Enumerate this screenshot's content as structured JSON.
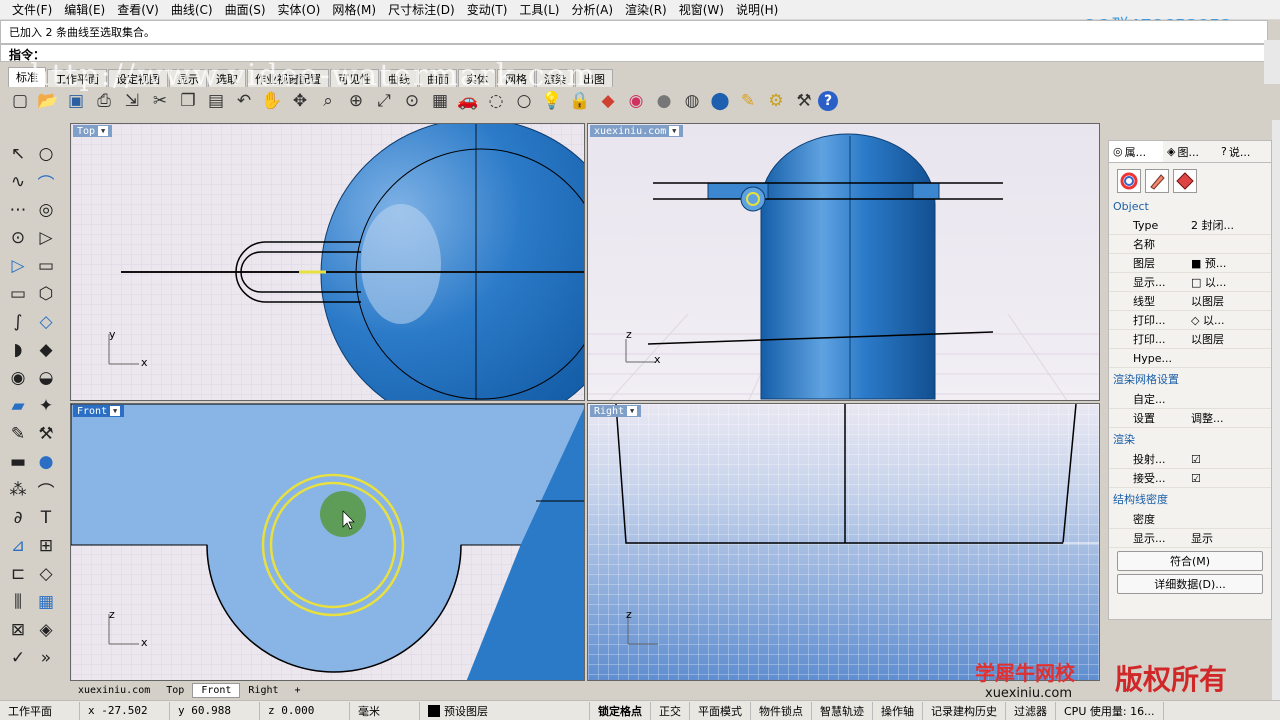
{
  "menu": [
    "文件(F)",
    "编辑(E)",
    "查看(V)",
    "曲线(C)",
    "曲面(S)",
    "实体(O)",
    "网格(M)",
    "尺寸标注(D)",
    "变动(T)",
    "工具(L)",
    "分析(A)",
    "渲染(R)",
    "视窗(W)",
    "说明(H)"
  ],
  "qq": "QQ群478653852",
  "history_text": "已加入 2 条曲线至选取集合。",
  "command_label": "指令：",
  "watermark": "http://www.video-watermark.com",
  "tabs": [
    "标准",
    "工作平面",
    "设定视图",
    "显示",
    "选取",
    "作业视窗配置",
    "可见性",
    "曲线",
    "曲面",
    "实体",
    "网格",
    "渲染",
    "出图"
  ],
  "toolbar_icons": [
    "new-file-icon",
    "open-icon",
    "save-icon",
    "print-icon",
    "import-icon",
    "cut-icon",
    "copy-icon",
    "paste-icon",
    "undo-icon",
    "pan-icon",
    "rotate-icon",
    "zoom-icon",
    "zoom-window-icon",
    "zoom-extents-icon",
    "zoom-selected-icon",
    "grid-icon",
    "car-icon",
    "select-icon",
    "circle-icon",
    "light-icon",
    "lock-icon",
    "layer-icon",
    "color-icon",
    "sphere-icon",
    "render-icon",
    "ball-icon",
    "pen-icon",
    "gear-icon",
    "options-icon",
    "help-icon"
  ],
  "viewports": {
    "top": {
      "name": "Top"
    },
    "persp": {
      "name": "xuexiniu.com"
    },
    "front": {
      "name": "Front"
    },
    "right": {
      "name": "Right"
    }
  },
  "axes": {
    "x": "x",
    "y": "y",
    "z": "z"
  },
  "panel": {
    "tabs": [
      "属...",
      "图...",
      "说..."
    ],
    "object_header": "Object",
    "rows": [
      {
        "k": "Type",
        "v": "2 封闭..."
      },
      {
        "k": "名称",
        "v": ""
      },
      {
        "k": "图层",
        "v": "■ 预..."
      },
      {
        "k": "显示...",
        "v": "□ 以..."
      },
      {
        "k": "线型",
        "v": "以图层"
      },
      {
        "k": "打印...",
        "v": "◇ 以..."
      },
      {
        "k": "打印...",
        "v": "以图层"
      },
      {
        "k": "Hype...",
        "v": ""
      }
    ],
    "mesh_header": "渲染网格设置",
    "mesh_rows": [
      {
        "k": "自定...",
        "v": ""
      },
      {
        "k": "设置",
        "v": "调整..."
      }
    ],
    "render_header": "渲染",
    "render_rows": [
      {
        "k": "投射...",
        "v": "☑"
      },
      {
        "k": "接受...",
        "v": "☑"
      }
    ],
    "iso_header": "结构线密度",
    "iso_rows": [
      {
        "k": "密度",
        "v": ""
      },
      {
        "k": "显示...",
        "v": "显示"
      }
    ],
    "match_label": "符合(M)",
    "details_label": "详细数据(D)..."
  },
  "viewport_tabs": [
    "xuexiniu.com",
    "Top",
    "Front",
    "Right",
    "+"
  ],
  "status": {
    "plane": "工作平面",
    "x": "x -27.502",
    "y": "y 60.988",
    "z": "z 0.000",
    "unit": "毫米",
    "layer": "预设图层",
    "osnap": "锁定格点",
    "ortho": "正交",
    "planar": "平面模式",
    "obj_snap": "物件锁点",
    "smart": "智慧轨迹",
    "gumball": "操作轴",
    "history": "记录建构历史",
    "filter": "过滤器",
    "cpu": "CPU 使用量: 16..."
  },
  "brand": {
    "cn": "学犀牛网校",
    "url": "xuexiniu.com",
    "rights": "版权所有"
  },
  "colors": {
    "accent": "#1f6fc0",
    "viewport_bg": "#e8e3ec",
    "label": "#7f9fc8"
  }
}
